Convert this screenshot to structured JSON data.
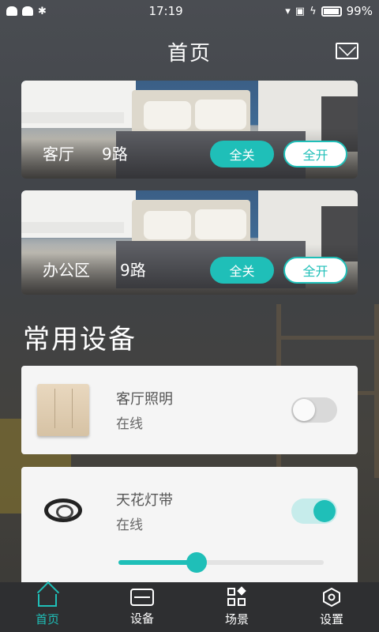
{
  "status_bar": {
    "time": "17:19",
    "battery": "99%",
    "left_icons": [
      "android-icon",
      "android-icon",
      "bluetooth-icon"
    ],
    "right_icons": [
      "wifi-icon",
      "no-sim-icon",
      "charging-icon",
      "battery-icon"
    ]
  },
  "header": {
    "title": "首页",
    "mail_icon": "mail-icon"
  },
  "rooms": [
    {
      "name": "客厅",
      "count": "9路",
      "off_label": "全关",
      "on_label": "全开"
    },
    {
      "name": "办公区",
      "count": "9路",
      "off_label": "全关",
      "on_label": "全开"
    }
  ],
  "section_title": "常用设备",
  "devices": [
    {
      "name": "客厅照明",
      "status": "在线",
      "toggle": "off",
      "icon": "switch-panel-icon"
    },
    {
      "name": "天花灯带",
      "status": "在线",
      "toggle": "on",
      "icon": "led-strip-icon",
      "brightness": 0.38
    }
  ],
  "tabbar": {
    "tabs": [
      {
        "label": "首页",
        "icon": "home-icon",
        "active": true
      },
      {
        "label": "设备",
        "icon": "device-icon",
        "active": false
      },
      {
        "label": "场景",
        "icon": "scene-icon",
        "active": false
      },
      {
        "label": "设置",
        "icon": "settings-icon",
        "active": false
      }
    ]
  },
  "colors": {
    "accent": "#1fbfb8",
    "tabbar_bg": "#2e2f31",
    "card_bg": "#f5f5f5"
  }
}
